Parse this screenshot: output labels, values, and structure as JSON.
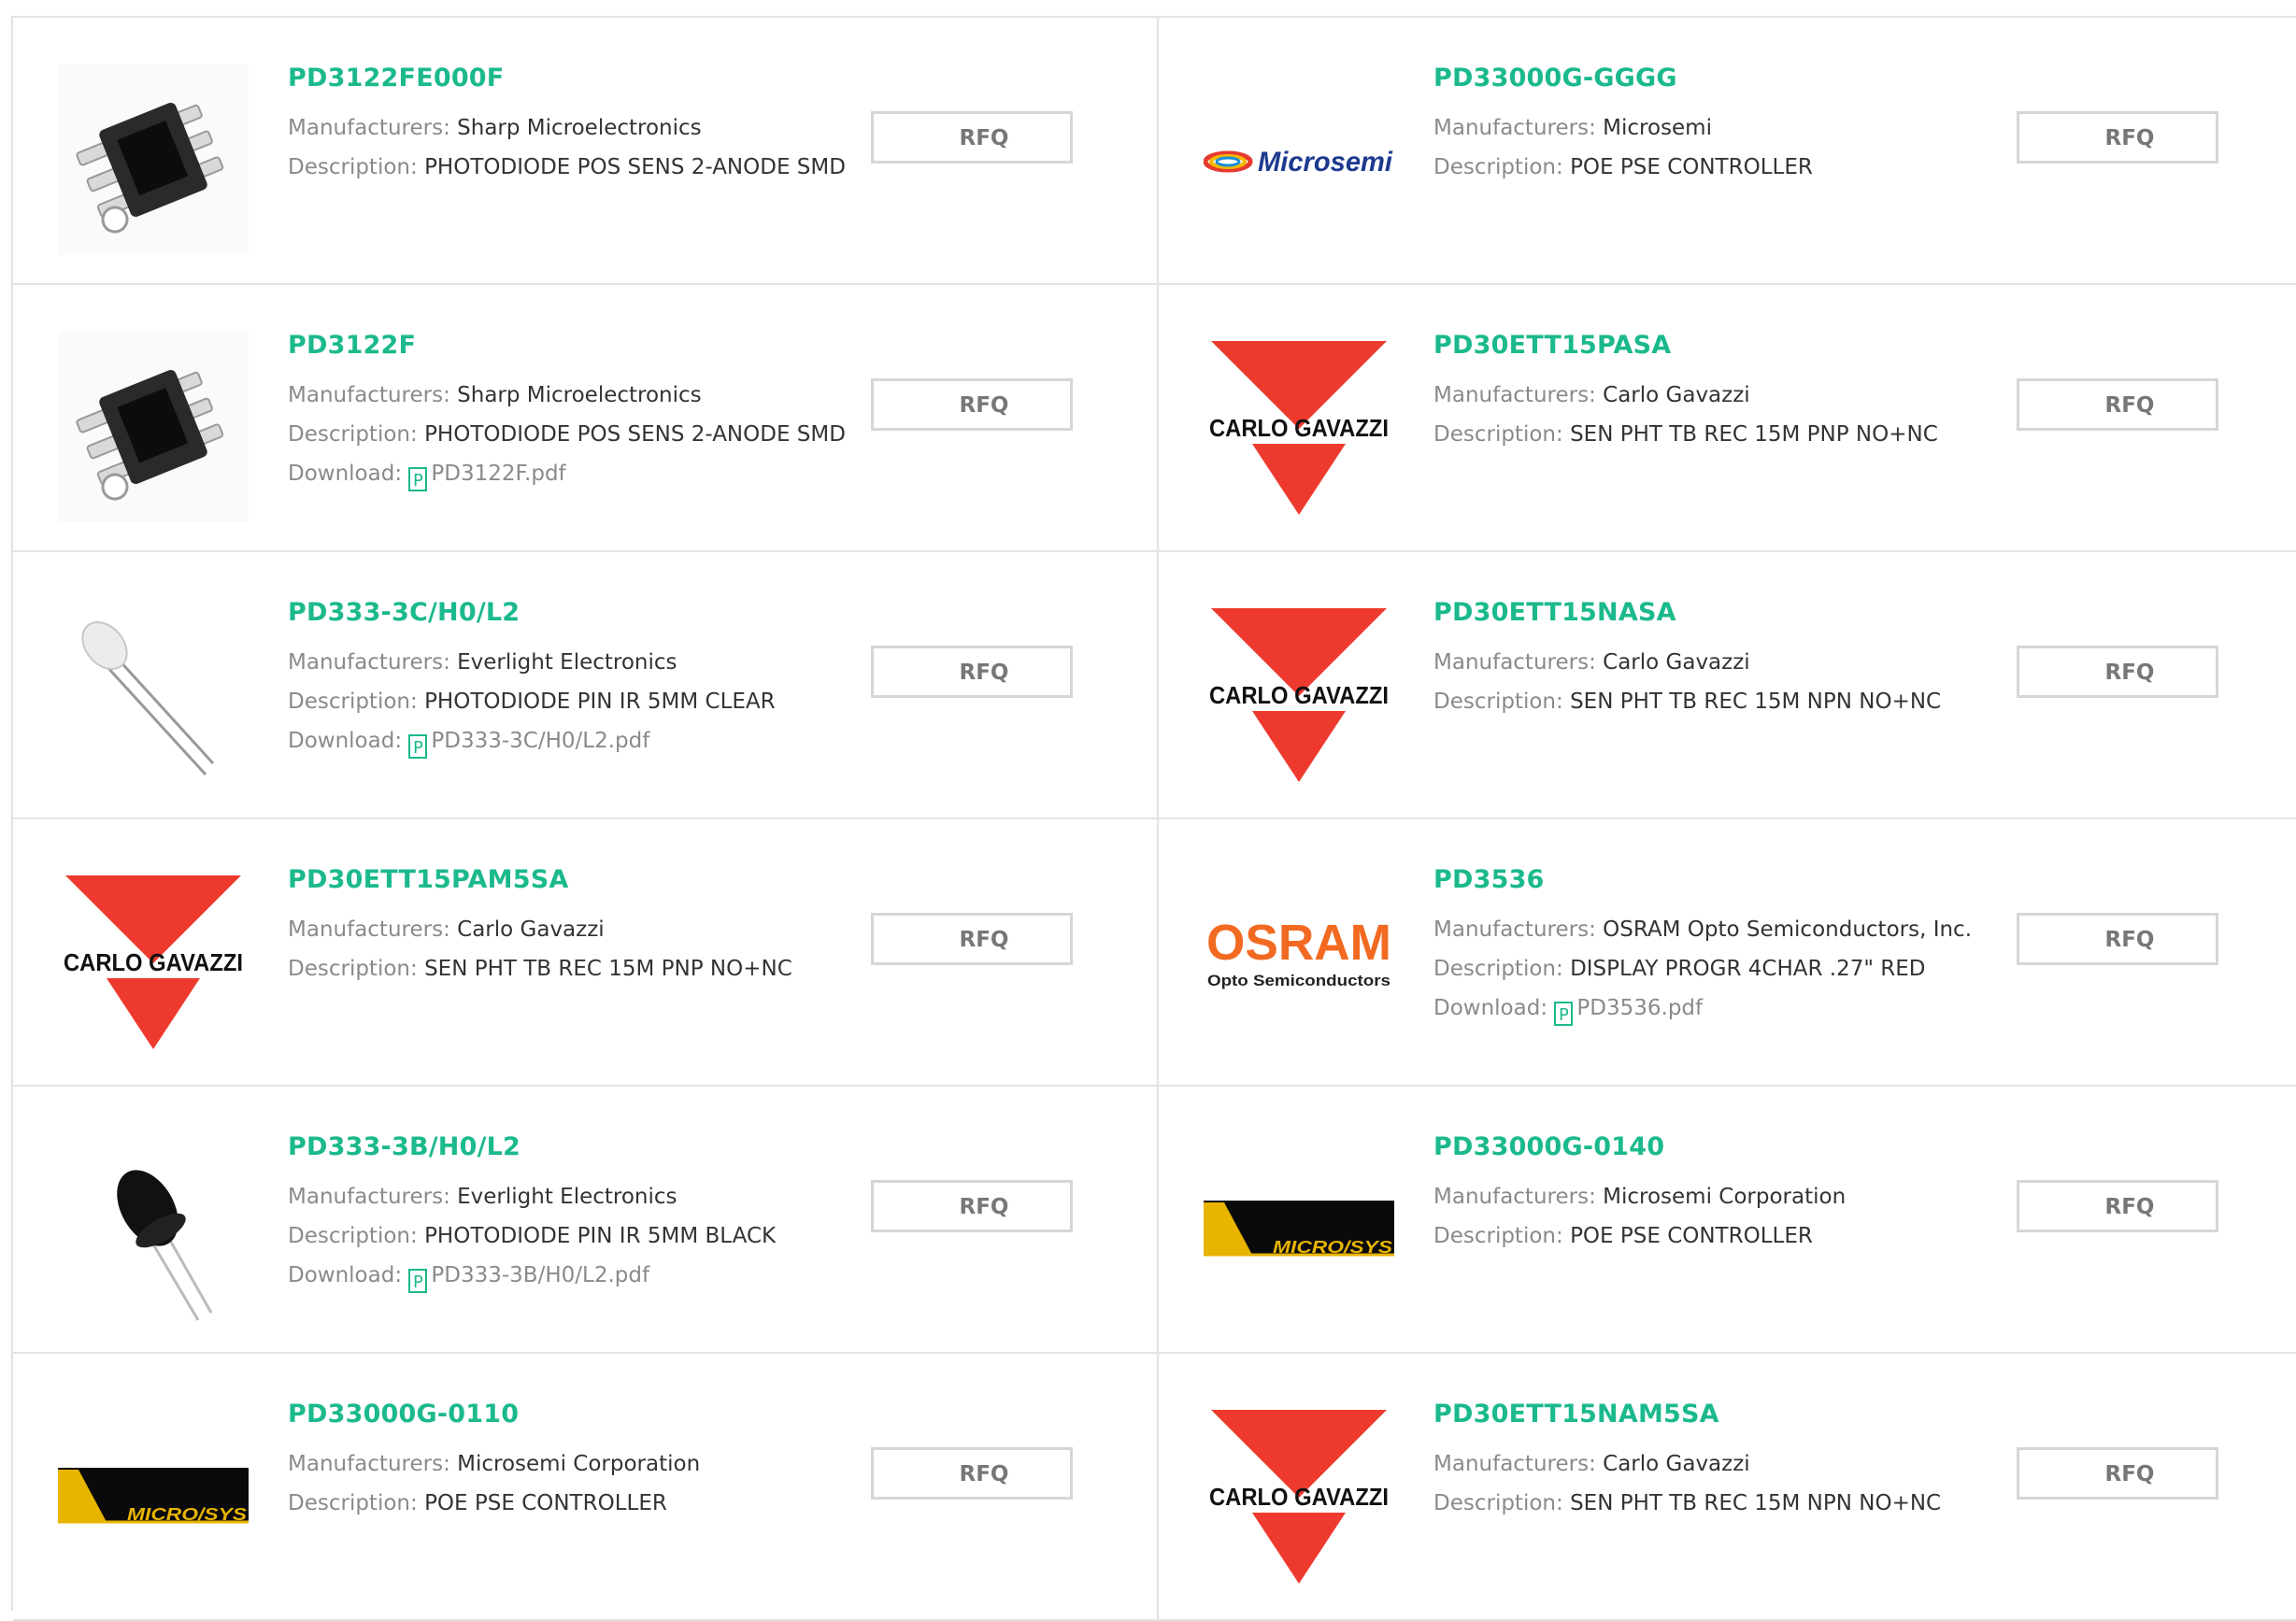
{
  "labels": {
    "manufacturers": "Manufacturers:",
    "description": "Description:",
    "download": "Download:",
    "rfq": "RFQ",
    "pdf_glyph": "P"
  },
  "brand_color": "#1bb98d",
  "products": [
    {
      "part": "PD3122FE000F",
      "manufacturer": "Sharp Microelectronics",
      "description": "PHOTODIODE POS SENS 2-ANODE SMD",
      "download": "",
      "image": "smd-photodiode-image"
    },
    {
      "part": "PD33000G-GGGG",
      "manufacturer": "Microsemi",
      "description": "POE PSE CONTROLLER",
      "download": "",
      "image": "microsemi-logo",
      "logo_text": "Microsemi"
    },
    {
      "part": "PD3122F",
      "manufacturer": "Sharp Microelectronics",
      "description": "PHOTODIODE POS SENS 2-ANODE SMD",
      "download": "PD3122F.pdf",
      "image": "smd-photodiode-image"
    },
    {
      "part": "PD30ETT15PASA",
      "manufacturer": "Carlo Gavazzi",
      "description": "SEN PHT TB REC 15M PNP NO+NC",
      "download": "",
      "image": "carlo-gavazzi-logo",
      "logo_text": "CARLO GAVAZZI"
    },
    {
      "part": "PD333-3C/H0/L2",
      "manufacturer": "Everlight Electronics",
      "description": "PHOTODIODE PIN IR 5MM CLEAR",
      "download": "PD333-3C/H0/L2.pdf",
      "image": "clear-led-image"
    },
    {
      "part": "PD30ETT15NASA",
      "manufacturer": "Carlo Gavazzi",
      "description": "SEN PHT TB REC 15M NPN NO+NC",
      "download": "",
      "image": "carlo-gavazzi-logo",
      "logo_text": "CARLO GAVAZZI"
    },
    {
      "part": "PD30ETT15PAM5SA",
      "manufacturer": "Carlo Gavazzi",
      "description": "SEN PHT TB REC 15M PNP NO+NC",
      "download": "",
      "image": "carlo-gavazzi-logo",
      "logo_text": "CARLO GAVAZZI"
    },
    {
      "part": "PD3536",
      "manufacturer": "OSRAM Opto Semiconductors, Inc.",
      "description": "DISPLAY PROGR 4CHAR .27\" RED",
      "download": "PD3536.pdf",
      "image": "osram-logo",
      "logo_text": "OSRAM",
      "logo_subtext": "Opto Semiconductors"
    },
    {
      "part": "PD333-3B/H0/L2",
      "manufacturer": "Everlight Electronics",
      "description": "PHOTODIODE PIN IR 5MM BLACK",
      "download": "PD333-3B/H0/L2.pdf",
      "image": "black-led-image"
    },
    {
      "part": "PD33000G-0140",
      "manufacturer": "Microsemi Corporation",
      "description": "POE PSE CONTROLLER",
      "download": "",
      "image": "microsys-logo",
      "logo_text": "MICRO/SYS"
    },
    {
      "part": "PD33000G-0110",
      "manufacturer": "Microsemi Corporation",
      "description": "POE PSE CONTROLLER",
      "download": "",
      "image": "microsys-logo",
      "logo_text": "MICRO/SYS"
    },
    {
      "part": "PD30ETT15NAM5SA",
      "manufacturer": "Carlo Gavazzi",
      "description": "SEN PHT TB REC 15M NPN NO+NC",
      "download": "",
      "image": "carlo-gavazzi-logo",
      "logo_text": "CARLO GAVAZZI"
    }
  ]
}
